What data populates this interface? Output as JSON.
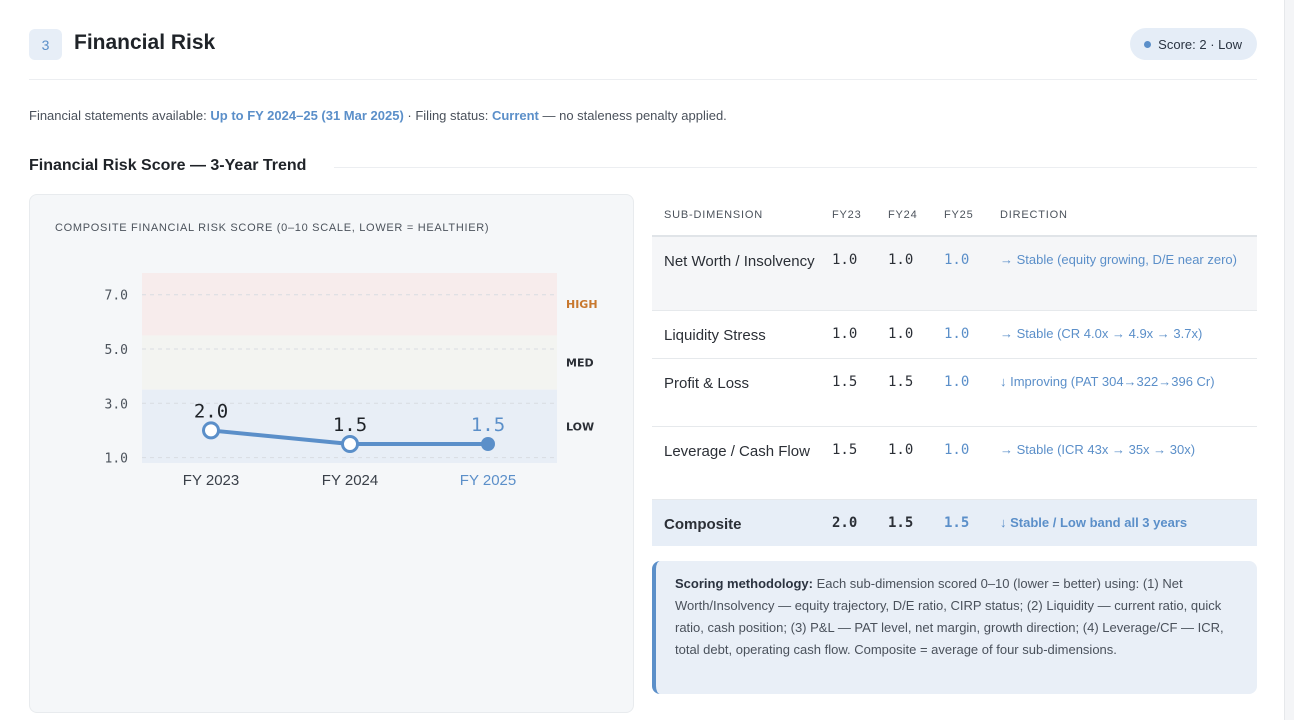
{
  "section": {
    "number": "3",
    "title": "Financial Risk",
    "score_badge": "Score: 2 · Low"
  },
  "statement": {
    "prefix": "Financial statements available: ",
    "period": "Up to FY 2024–25 (31 Mar 2025)",
    "mid": " · Filing status: ",
    "status": "Current",
    "suffix": " — no staleness penalty applied."
  },
  "trend_heading": "Financial Risk Score — 3-Year Trend",
  "chart_caption": "COMPOSITE FINANCIAL RISK SCORE (0–10 SCALE, LOWER = HEALTHIER)",
  "chart_data": {
    "type": "line",
    "title": "COMPOSITE FINANCIAL RISK SCORE (0–10 SCALE, LOWER = HEALTHIER)",
    "categories": [
      "FY 2023",
      "FY 2024",
      "FY 2025"
    ],
    "values": [
      2.0,
      1.5,
      1.5
    ],
    "value_labels": [
      "2.0",
      "1.5",
      "1.5"
    ],
    "y_ticks": [
      "7.0",
      "5.0",
      "3.0",
      "1.0"
    ],
    "ylim": [
      0.8,
      7.8
    ],
    "bands": [
      {
        "label": "HIGH",
        "from": 5.5,
        "to": 7.8,
        "color": "#f7ecec",
        "label_color": "#c8782e"
      },
      {
        "label": "MED",
        "from": 3.5,
        "to": 5.5,
        "color": "#f3f4f1",
        "label_color": "#2b2f36"
      },
      {
        "label": "LOW",
        "from": 0.8,
        "to": 3.5,
        "color": "#e8eef6",
        "label_color": "#2b2f36"
      }
    ],
    "line_color": "#5b8fc9",
    "highlight_color": "#5b8fc9",
    "grid": true
  },
  "table": {
    "headers": [
      "SUB-DIMENSION",
      "FY23",
      "FY24",
      "FY25",
      "DIRECTION"
    ],
    "rows": [
      {
        "name": "Net Worth / Insolvency",
        "fy23": "1.0",
        "fy24": "1.0",
        "fy25": "1.0",
        "direction": "→ Stable (equity growing, D/E near zero)"
      },
      {
        "name": "Liquidity Stress",
        "fy23": "1.0",
        "fy24": "1.0",
        "fy25": "1.0",
        "direction": "→ Stable (CR 4.0x → 4.9x → 3.7x)"
      },
      {
        "name": "Profit & Loss",
        "fy23": "1.5",
        "fy24": "1.5",
        "fy25": "1.0",
        "direction": "↓ Improving (PAT 304→322→396 Cr)"
      },
      {
        "name": "Leverage / Cash Flow",
        "fy23": "1.5",
        "fy24": "1.0",
        "fy25": "1.0",
        "direction": "→ Stable (ICR 43x → 35x → 30x)"
      }
    ],
    "composite": {
      "name": "Composite",
      "fy23": "2.0",
      "fy24": "1.5",
      "fy25": "1.5",
      "direction": "↓ Stable / Low band all 3 years"
    }
  },
  "methodology": {
    "label": "Scoring methodology:",
    "text": " Each sub-dimension scored 0–10 (lower = better) using: (1) Net Worth/Insolvency — equity trajectory, D/E ratio, CIRP status; (2) Liquidity — current ratio, quick ratio, cash position; (3) P&L — PAT level, net margin, growth direction; (4) Leverage/CF — ICR, total debt, operating cash flow. Composite = average of four sub-dimensions."
  }
}
